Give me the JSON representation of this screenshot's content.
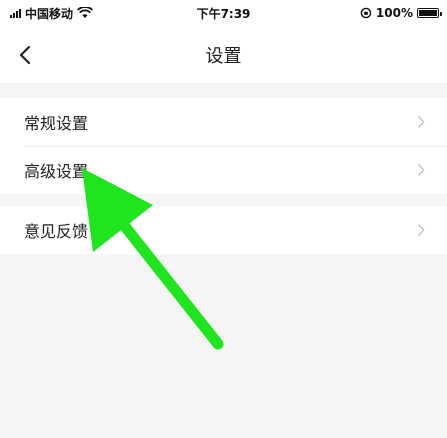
{
  "status_bar": {
    "carrier": "中国移动",
    "time": "下午7:39",
    "battery": "100%",
    "icons": [
      "signal-icon",
      "wifi-icon",
      "orientation-lock-icon",
      "battery-icon"
    ]
  },
  "header": {
    "title": "设置",
    "back_icon": "chevron-left-icon"
  },
  "groups": [
    {
      "items": [
        {
          "label": "常规设置"
        },
        {
          "label": "高级设置"
        }
      ]
    },
    {
      "items": [
        {
          "label": "意见反馈"
        }
      ]
    }
  ],
  "colors": {
    "background": "#f5f5f5",
    "surface": "#ffffff",
    "chevron": "#c7c7c7",
    "annotation": "#1fe51f"
  }
}
